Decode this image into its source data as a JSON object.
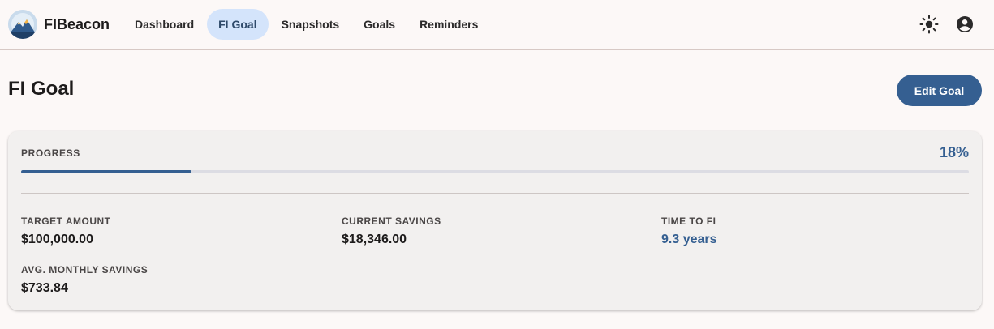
{
  "app": {
    "brand_name": "FIBeacon",
    "logo_icon": "mountain-logo-icon"
  },
  "nav": {
    "items": [
      {
        "label": "Dashboard",
        "active": false
      },
      {
        "label": "FI Goal",
        "active": true
      },
      {
        "label": "Snapshots",
        "active": false
      },
      {
        "label": "Goals",
        "active": false
      },
      {
        "label": "Reminders",
        "active": false
      }
    ]
  },
  "top_actions": {
    "theme_icon": "sun-icon",
    "account_icon": "account-circle-icon"
  },
  "page": {
    "title": "FI Goal",
    "edit_button_label": "Edit Goal"
  },
  "progress": {
    "label": "PROGRESS",
    "percent_text": "18%",
    "fraction": 0.18
  },
  "stats": {
    "target_amount": {
      "label": "TARGET AMOUNT",
      "value": "$100,000.00"
    },
    "current_savings": {
      "label": "CURRENT SAVINGS",
      "value": "$18,346.00"
    },
    "time_to_fi": {
      "label": "TIME TO FI",
      "value": "9.3 years"
    },
    "avg_monthly_savings": {
      "label": "AVG. MONTHLY SAVINGS",
      "value": "$733.84"
    }
  },
  "colors": {
    "primary": "#355f91",
    "nav_active_bg": "#d4e4fb",
    "background": "#fcf8f7",
    "card_bg": "#f2f0ef"
  }
}
